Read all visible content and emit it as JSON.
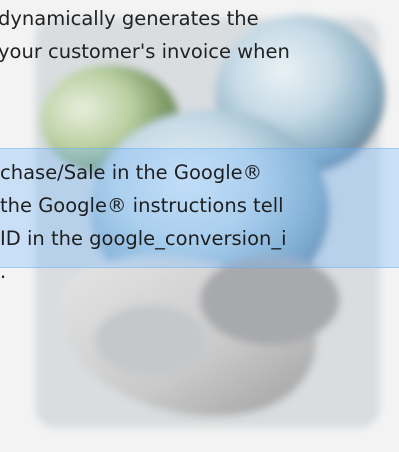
{
  "intro": {
    "line1": "dynamically generates the",
    "line2": "your customer's invoice when"
  },
  "callout": {
    "line1": "chase/Sale in the Google®",
    "line2": " the Google® instructions tell",
    "line3": "ID in the google_conversion_i",
    "line4": "."
  },
  "colors": {
    "callout_background": "#78b9ff",
    "page_background": "#f3f3f3"
  }
}
